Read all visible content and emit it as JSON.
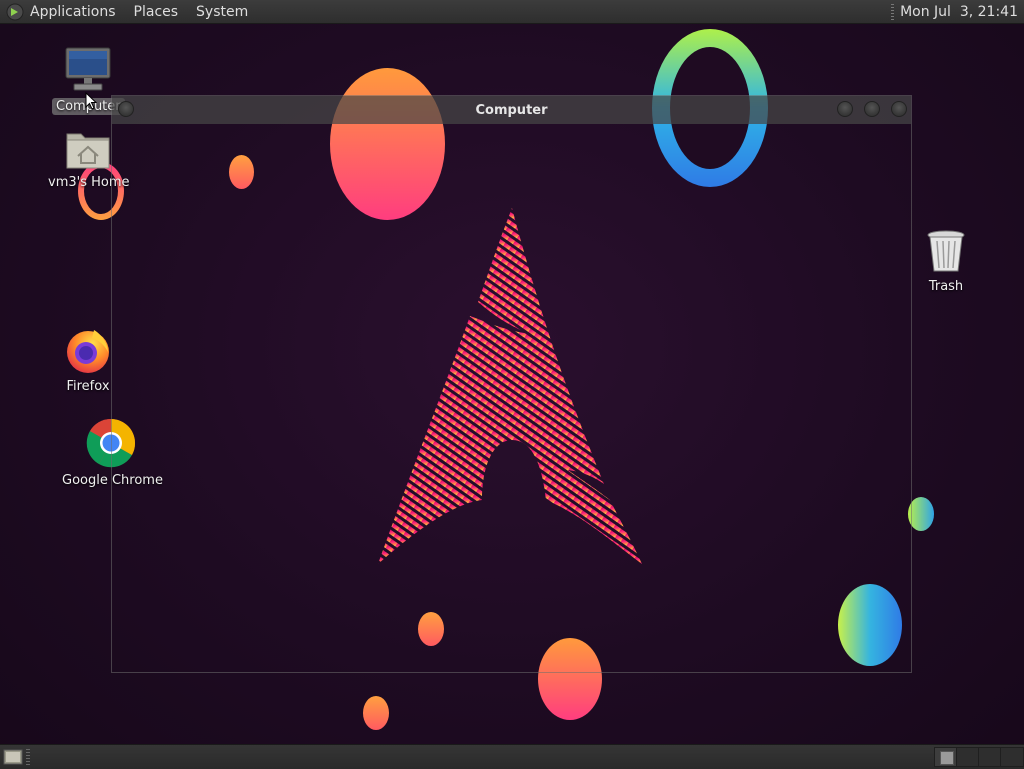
{
  "top_panel": {
    "menus": [
      "Applications",
      "Places",
      "System"
    ],
    "clock": "Mon Jul  3, 21:41"
  },
  "desktop_icons": [
    {
      "label": "Computer",
      "icon": "computer-icon",
      "selected": true
    },
    {
      "label": "vm3's Home",
      "icon": "home-folder-icon",
      "selected": false
    },
    {
      "label": "Firefox",
      "icon": "firefox-icon",
      "selected": false
    },
    {
      "label": "Google Chrome",
      "icon": "chrome-icon",
      "selected": false
    },
    {
      "label": "Trash",
      "icon": "trash-icon",
      "selected": false
    }
  ],
  "window": {
    "title": "Computer",
    "buttons": [
      "minimize",
      "maximize",
      "close"
    ]
  },
  "bottom_panel": {
    "workspaces": 4,
    "active_workspace": 1
  }
}
